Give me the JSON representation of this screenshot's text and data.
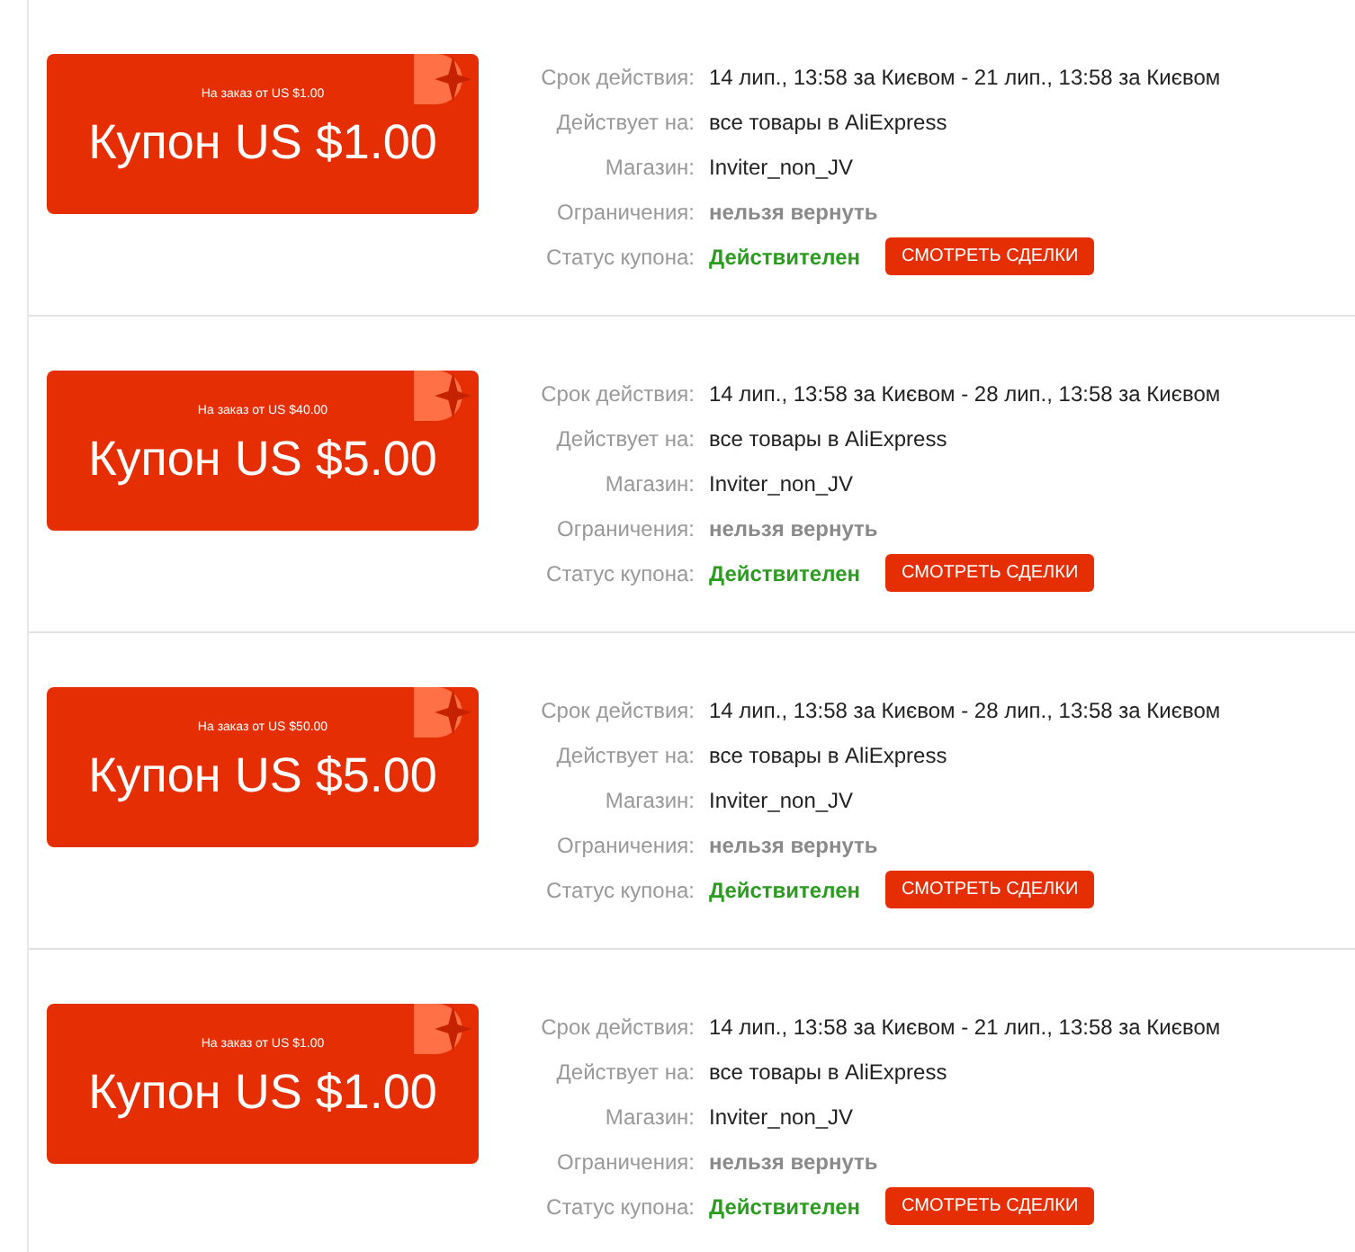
{
  "coupons": [
    {
      "min_order": "На заказ от US $1.00",
      "title": "Купон US $1.00",
      "rows": [
        {
          "kind": "plain",
          "label": "Срок действия:",
          "value": "14 лип., 13:58 за Києвом - 21 лип., 13:58 за Києвом"
        },
        {
          "kind": "plain",
          "label": "Действует на:",
          "value": "все товары в AliExpress"
        },
        {
          "kind": "plain",
          "label": "Магазин:",
          "value": "Inviter_non_JV"
        },
        {
          "kind": "muted",
          "label": "Ограничения:",
          "value": "нельзя вернуть"
        },
        {
          "kind": "status",
          "label": "Статус купона:",
          "value": "Действителен",
          "button": "СМОТРЕТЬ СДЕЛКИ"
        }
      ]
    },
    {
      "min_order": "На заказ от US $40.00",
      "title": "Купон US $5.00",
      "rows": [
        {
          "kind": "plain",
          "label": "Срок действия:",
          "value": "14 лип., 13:58 за Києвом - 28 лип., 13:58 за Києвом"
        },
        {
          "kind": "plain",
          "label": "Действует на:",
          "value": "все товары в AliExpress"
        },
        {
          "kind": "plain",
          "label": "Магазин:",
          "value": "Inviter_non_JV"
        },
        {
          "kind": "muted",
          "label": "Ограничения:",
          "value": "нельзя вернуть"
        },
        {
          "kind": "status",
          "label": "Статус купона:",
          "value": "Действителен",
          "button": "СМОТРЕТЬ СДЕЛКИ"
        }
      ]
    },
    {
      "min_order": "На заказ от US $50.00",
      "title": "Купон US $5.00",
      "rows": [
        {
          "kind": "plain",
          "label": "Срок действия:",
          "value": "14 лип., 13:58 за Києвом - 28 лип., 13:58 за Києвом"
        },
        {
          "kind": "plain",
          "label": "Действует на:",
          "value": "все товары в AliExpress"
        },
        {
          "kind": "plain",
          "label": "Магазин:",
          "value": "Inviter_non_JV"
        },
        {
          "kind": "muted",
          "label": "Ограничения:",
          "value": "нельзя вернуть"
        },
        {
          "kind": "status",
          "label": "Статус купона:",
          "value": "Действителен",
          "button": "СМОТРЕТЬ СДЕЛКИ"
        }
      ]
    },
    {
      "min_order": "На заказ от US $1.00",
      "title": "Купон US $1.00",
      "rows": [
        {
          "kind": "plain",
          "label": "Срок действия:",
          "value": "14 лип., 13:58 за Києвом - 21 лип., 13:58 за Києвом"
        },
        {
          "kind": "plain",
          "label": "Действует на:",
          "value": "все товары в AliExpress"
        },
        {
          "kind": "plain",
          "label": "Магазин:",
          "value": "Inviter_non_JV"
        },
        {
          "kind": "muted",
          "label": "Ограничения:",
          "value": "нельзя вернуть"
        },
        {
          "kind": "status",
          "label": "Статус купона:",
          "value": "Действителен",
          "button": "СМОТРЕТЬ СДЕЛКИ"
        }
      ]
    }
  ]
}
